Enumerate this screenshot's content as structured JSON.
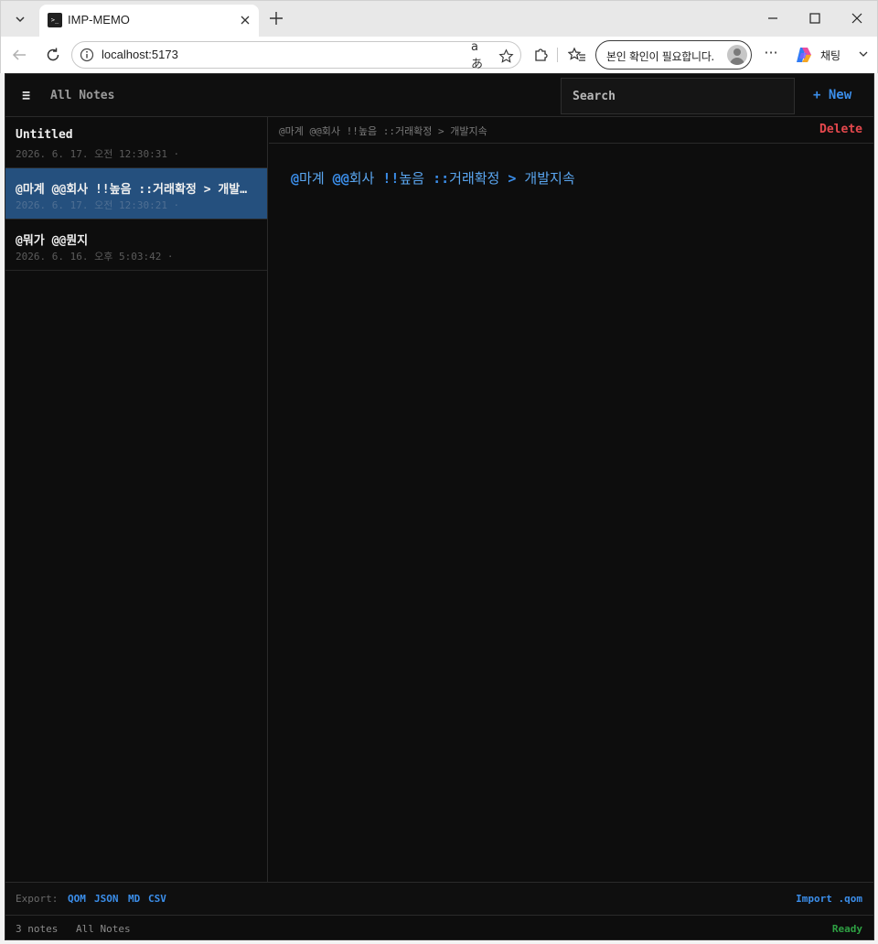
{
  "browser": {
    "tab_title": "IMP-MEMO",
    "url": "localhost:5173",
    "identity_prompt": "본인 확인이 필요합니다.",
    "copilot_label": "채팅",
    "translate_icon_text": "aあ"
  },
  "header": {
    "menu_icon": "≡",
    "title": "All Notes",
    "search_placeholder": "Search",
    "new_label": "+ New"
  },
  "notes": [
    {
      "title": "Untitled",
      "date": "2026. 6. 17. 오전 12:30:31 ·",
      "selected": false
    },
    {
      "title": "@마계 @@회사 !!높음 ::거래확정 > 개발지속",
      "date": "2026. 6. 17. 오전 12:30:21 ·",
      "selected": true
    },
    {
      "title": "@뭐가 @@뭔지",
      "date": "2026. 6. 16. 오후 5:03:42 ·",
      "selected": false
    }
  ],
  "editor": {
    "path": "@마계 @@회사 !!높음 ::거래확정 > 개발지속",
    "delete_label": "Delete",
    "tokens": [
      {
        "text": "@",
        "kind": "sym"
      },
      {
        "text": "마계 ",
        "kind": "txt"
      },
      {
        "text": "@@",
        "kind": "sym"
      },
      {
        "text": "회사 ",
        "kind": "txt"
      },
      {
        "text": "!!",
        "kind": "sym"
      },
      {
        "text": "높음 ",
        "kind": "txt"
      },
      {
        "text": "::",
        "kind": "sym"
      },
      {
        "text": "거래확정 ",
        "kind": "txt"
      },
      {
        "text": ">",
        "kind": "sym"
      },
      {
        "text": " 개발지속",
        "kind": "txt"
      }
    ]
  },
  "export": {
    "label": "Export:",
    "formats": [
      "QOM",
      "JSON",
      "MD",
      "CSV"
    ],
    "import_label": "Import .qom"
  },
  "status": {
    "count": "3 notes",
    "filter": "All Notes",
    "state": "Ready"
  },
  "colors": {
    "accent": "#3b8eea",
    "selected_bg": "#25507e",
    "danger": "#e5484d",
    "ready": "#2ea043"
  }
}
